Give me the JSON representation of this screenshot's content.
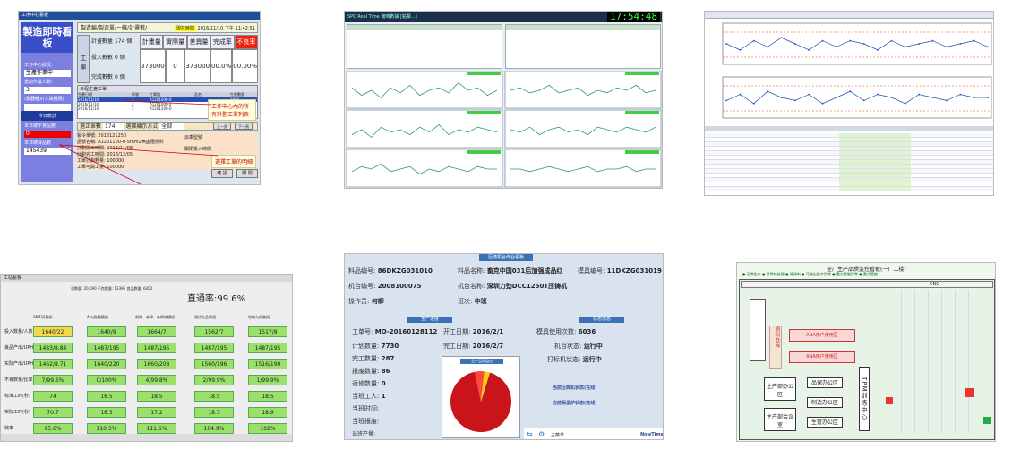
{
  "tile1": {
    "window_title": "工序中心看板",
    "app_title": "製造即時看板",
    "header_title": "製造編/製造單/一線/計畫數/",
    "time_label": "現在時間",
    "time_value": "2016/11/10 下午 11:42:51",
    "work_center_label": "工作中心狀況:",
    "work_center_value": "生產作業中",
    "people_label": "當前作業人數:",
    "people_value": "3",
    "team_label": "(製器種)/(人員種類)",
    "today_label": "今日統計",
    "reject_label": "本日總不良品數",
    "reject_value": "0",
    "total_label": "本日總良品數",
    "total_value": "145439",
    "plan_qty_label": "計畫數量",
    "plan_qty_value": "174",
    "stats_headers": [
      "計畫量",
      "實際量",
      "差異量",
      "完成率",
      "不良率"
    ],
    "stats_values": [
      "373000",
      "0",
      "373000",
      "00.0%",
      "00.00%"
    ],
    "input_label": "投入數數",
    "input_value": "0",
    "done_label": "完成數數",
    "done_value": "0",
    "unit": "個",
    "side_label": "工單",
    "list_title": "日程生產工單",
    "list_headers": [
      "生產日期",
      "序號",
      "工單號",
      "品名",
      "生產數量"
    ],
    "list_rows": [
      [
        "2016/11/10",
        "1",
        "A1201000-0",
        "",
        "1000"
      ],
      [
        "2016/11/10",
        "2",
        "A1201000-2",
        "",
        "1000"
      ],
      [
        "2016/11/10",
        "3",
        "A1201100-0",
        "",
        "1000"
      ]
    ],
    "callout1": "工作中心內的所有計劃工單列表",
    "work_order_label": "選正單數",
    "work_order_value": "174",
    "mode_label": "選擇顯示方式",
    "mode_value": "全部",
    "details": [
      "製令單號: 2016121250",
      "品號名稱: A1201100-0-5mm2無鹵阻燃料",
      "計劃開工時間: 2016/11/08",
      "計劃完工時間: 2016/12/05",
      "工單計劃數量: 100000",
      "工單可開工量: 100000"
    ],
    "callout2": "選擇工單的明細",
    "dispatch_label": "派車型號",
    "close_label": "關閉投入時間",
    "btn_ok": "確 認",
    "btn_close": "關 閉",
    "btn_prev": "上一頁",
    "btn_next": "下一頁"
  },
  "tile2": {
    "title": "SPC Real Time 實時數據 [點擊...]",
    "clock": "17:54:48",
    "panels": [
      {
        "y": [
          0.6,
          0.3,
          0.5,
          0.2,
          0.6,
          0.4,
          0.7,
          0.3,
          0.5,
          0.6,
          0.4,
          0.8,
          0.5,
          0.6,
          0.3,
          0.5
        ]
      },
      {
        "y": [
          0.5,
          0.6,
          0.4,
          0.5,
          0.7,
          0.4,
          0.5,
          0.6,
          0.3,
          0.5,
          0.4,
          0.6,
          0.5,
          0.7,
          0.4,
          0.5
        ]
      },
      {
        "y": [
          0.3,
          0.5,
          0.2,
          0.6,
          0.4,
          0.5,
          0.3,
          0.6,
          0.4,
          0.7,
          0.3,
          0.5,
          0.4,
          0.6,
          0.5,
          0.4
        ]
      },
      {
        "y": [
          0.5,
          0.4,
          0.6,
          0.3,
          0.5,
          0.6,
          0.4,
          0.5,
          0.3,
          0.6,
          0.5,
          0.4,
          0.6,
          0.5,
          0.4,
          0.6
        ]
      },
      {
        "y": [
          0.4,
          0.6,
          0.5,
          0.7,
          0.4,
          0.5,
          0.6,
          0.3,
          0.5,
          0.4,
          0.6,
          0.5,
          0.4,
          0.6,
          0.5,
          0.5
        ]
      },
      {
        "y": [
          0.5,
          0.5,
          0.4,
          0.5,
          0.6,
          0.5,
          0.4,
          0.5,
          0.6,
          0.4,
          0.5,
          0.5,
          0.6,
          0.4,
          0.5,
          0.5
        ]
      }
    ]
  },
  "tile3": {
    "series_top": [
      0.5,
      0.3,
      0.6,
      0.4,
      0.7,
      0.5,
      0.3,
      0.6,
      0.4,
      0.6,
      0.5,
      0.3,
      0.6,
      0.4,
      0.5,
      0.6,
      0.4,
      0.5,
      0.6,
      0.4
    ],
    "series_mid": [
      0.4,
      0.6,
      0.3,
      0.7,
      0.5,
      0.4,
      0.6,
      0.3,
      0.5,
      0.7,
      0.4,
      0.6,
      0.5,
      0.3,
      0.6,
      0.5,
      0.4,
      0.6,
      0.5,
      0.5
    ],
    "table_rows": 13
  },
  "tile4": {
    "window_title": "工站看板",
    "counts": "总数量: 20,690  不良数量: 13396  良品数量: 6402",
    "yield_label": "直通率:99.6%",
    "col_headers": [
      "SMT/开贴机",
      "AI与贴插模组",
      "前焊、补焊、补焊线模组",
      "测试与品质组",
      "包装与组装组"
    ],
    "rows": [
      {
        "label": "投入数量/人数",
        "cells": [
          "1640/22",
          "1640/9",
          "1664/7",
          "1562/7",
          "1517/8"
        ],
        "colors": [
          "#f5d94a",
          "#9be06a",
          "#9be06a",
          "#9be06a",
          "#9be06a"
        ]
      },
      {
        "label": "良品产出/UPH",
        "cells": [
          "1483/8.84",
          "1487/195",
          "1487/195",
          "1487/195",
          "1487/195"
        ],
        "colors": [
          "#9be06a",
          "#9be06a",
          "#9be06a",
          "#9be06a",
          "#9be06a"
        ]
      },
      {
        "label": "实际产出/UPH",
        "cells": [
          "1462/8.71",
          "1640/220",
          "1660/208",
          "1560/196",
          "1516/190"
        ],
        "colors": [
          "#9be06a",
          "#9be06a",
          "#9be06a",
          "#9be06a",
          "#9be06a"
        ]
      },
      {
        "label": "不良数量/比率",
        "cells": [
          "7/99.6%",
          "0/100%",
          "4/99.8%",
          "2/99.9%",
          "1/99.9%"
        ],
        "colors": [
          "#9be06a",
          "#9be06a",
          "#9be06a",
          "#9be06a",
          "#9be06a"
        ]
      },
      {
        "label": "标准工时(秒)",
        "cells": [
          "74",
          "18.5",
          "18.5",
          "18.5",
          "18.5"
        ],
        "colors": [
          "#9be06a",
          "#9be06a",
          "#9be06a",
          "#9be06a",
          "#9be06a"
        ]
      },
      {
        "label": "实际工时(秒)",
        "cells": [
          "70.7",
          "18.3",
          "17.2",
          "18.3",
          "18.9"
        ],
        "colors": [
          "#9be06a",
          "#9be06a",
          "#9be06a",
          "#9be06a",
          "#9be06a"
        ]
      },
      {
        "label": "效率",
        "cells": [
          "95.6%",
          "110.3%",
          "111.6%",
          "104.9%",
          "102%"
        ],
        "colors": [
          "#9be06a",
          "#9be06a",
          "#9be06a",
          "#9be06a",
          "#9be06a"
        ]
      }
    ]
  },
  "tile5": {
    "title": "压铸机台作业看板",
    "mat_code_label": "料品编号:",
    "mat_code": "86DKZG031010",
    "mat_name_label": "料品名称:",
    "mat_name": "畜克中国031后加强成品红",
    "mold_label": "模具编号:",
    "mold": "11DKZG031019",
    "machine_code_label": "机台编号:",
    "machine_code": "2008100075",
    "machine_name_label": "机台名称:",
    "machine_name": "深圳力劲DCC1250T压铸机",
    "operator_label": "操作员:",
    "operator": "何柳",
    "shift_label": "班次:",
    "shift": "中班",
    "prod_section": "生产进度",
    "status_section": "状态信息",
    "order_label": "工单号:",
    "order": "MO-20160128112",
    "start_label": "开工日期:",
    "start": "2016/2/1",
    "plan_label": "计划数量:",
    "plan": "7730",
    "end_label": "完工日期:",
    "end": "2016/2/7",
    "done_label": "完工数量:",
    "done": "287",
    "reject_label": "报废数量:",
    "reject": "86",
    "repair_label": "返修数量:",
    "repair": "0",
    "workers_label": "当班工人:",
    "workers": "1",
    "cur_start_label": "当班时间:",
    "cur_start": "",
    "cur_done_label": "当班报废:",
    "cur_done": "",
    "cur_ng_label": "当班产量:",
    "cur_ng": "",
    "pie_title": "生产品质监控",
    "pie_values": [
      0.92,
      0.05,
      0.03
    ],
    "mold_count_label": "模具使用次数:",
    "mold_count": "6036",
    "mstate_label": "机台状态:",
    "mstate": "运行中",
    "pstate_label": "打标机状态:",
    "pstate": "运行中",
    "pstatus1": "当前压铸机状态(在线)",
    "pstatus2": "当前保温炉状态(在线)",
    "footer_left": "主菜单",
    "footer_right": "NowTime"
  },
  "tile6": {
    "title": "全厂生产品质监控看板(一厂二楼)",
    "legend": "● 正常生产  ● 异常待处理  ● 停线中  ● 可能出生产异常  ● 重点管制异常  ● 重点管控",
    "office1": "生产部办公区",
    "office2": "生产部会议室",
    "office3": "品保办公区",
    "office4": "制造办公区",
    "office5": "生管办公区",
    "center": "TPM训练中心",
    "area1": "ANA用户使用区",
    "area2": "ANA用户使用区",
    "storage": "原料仓库",
    "cnc": "CNC"
  }
}
